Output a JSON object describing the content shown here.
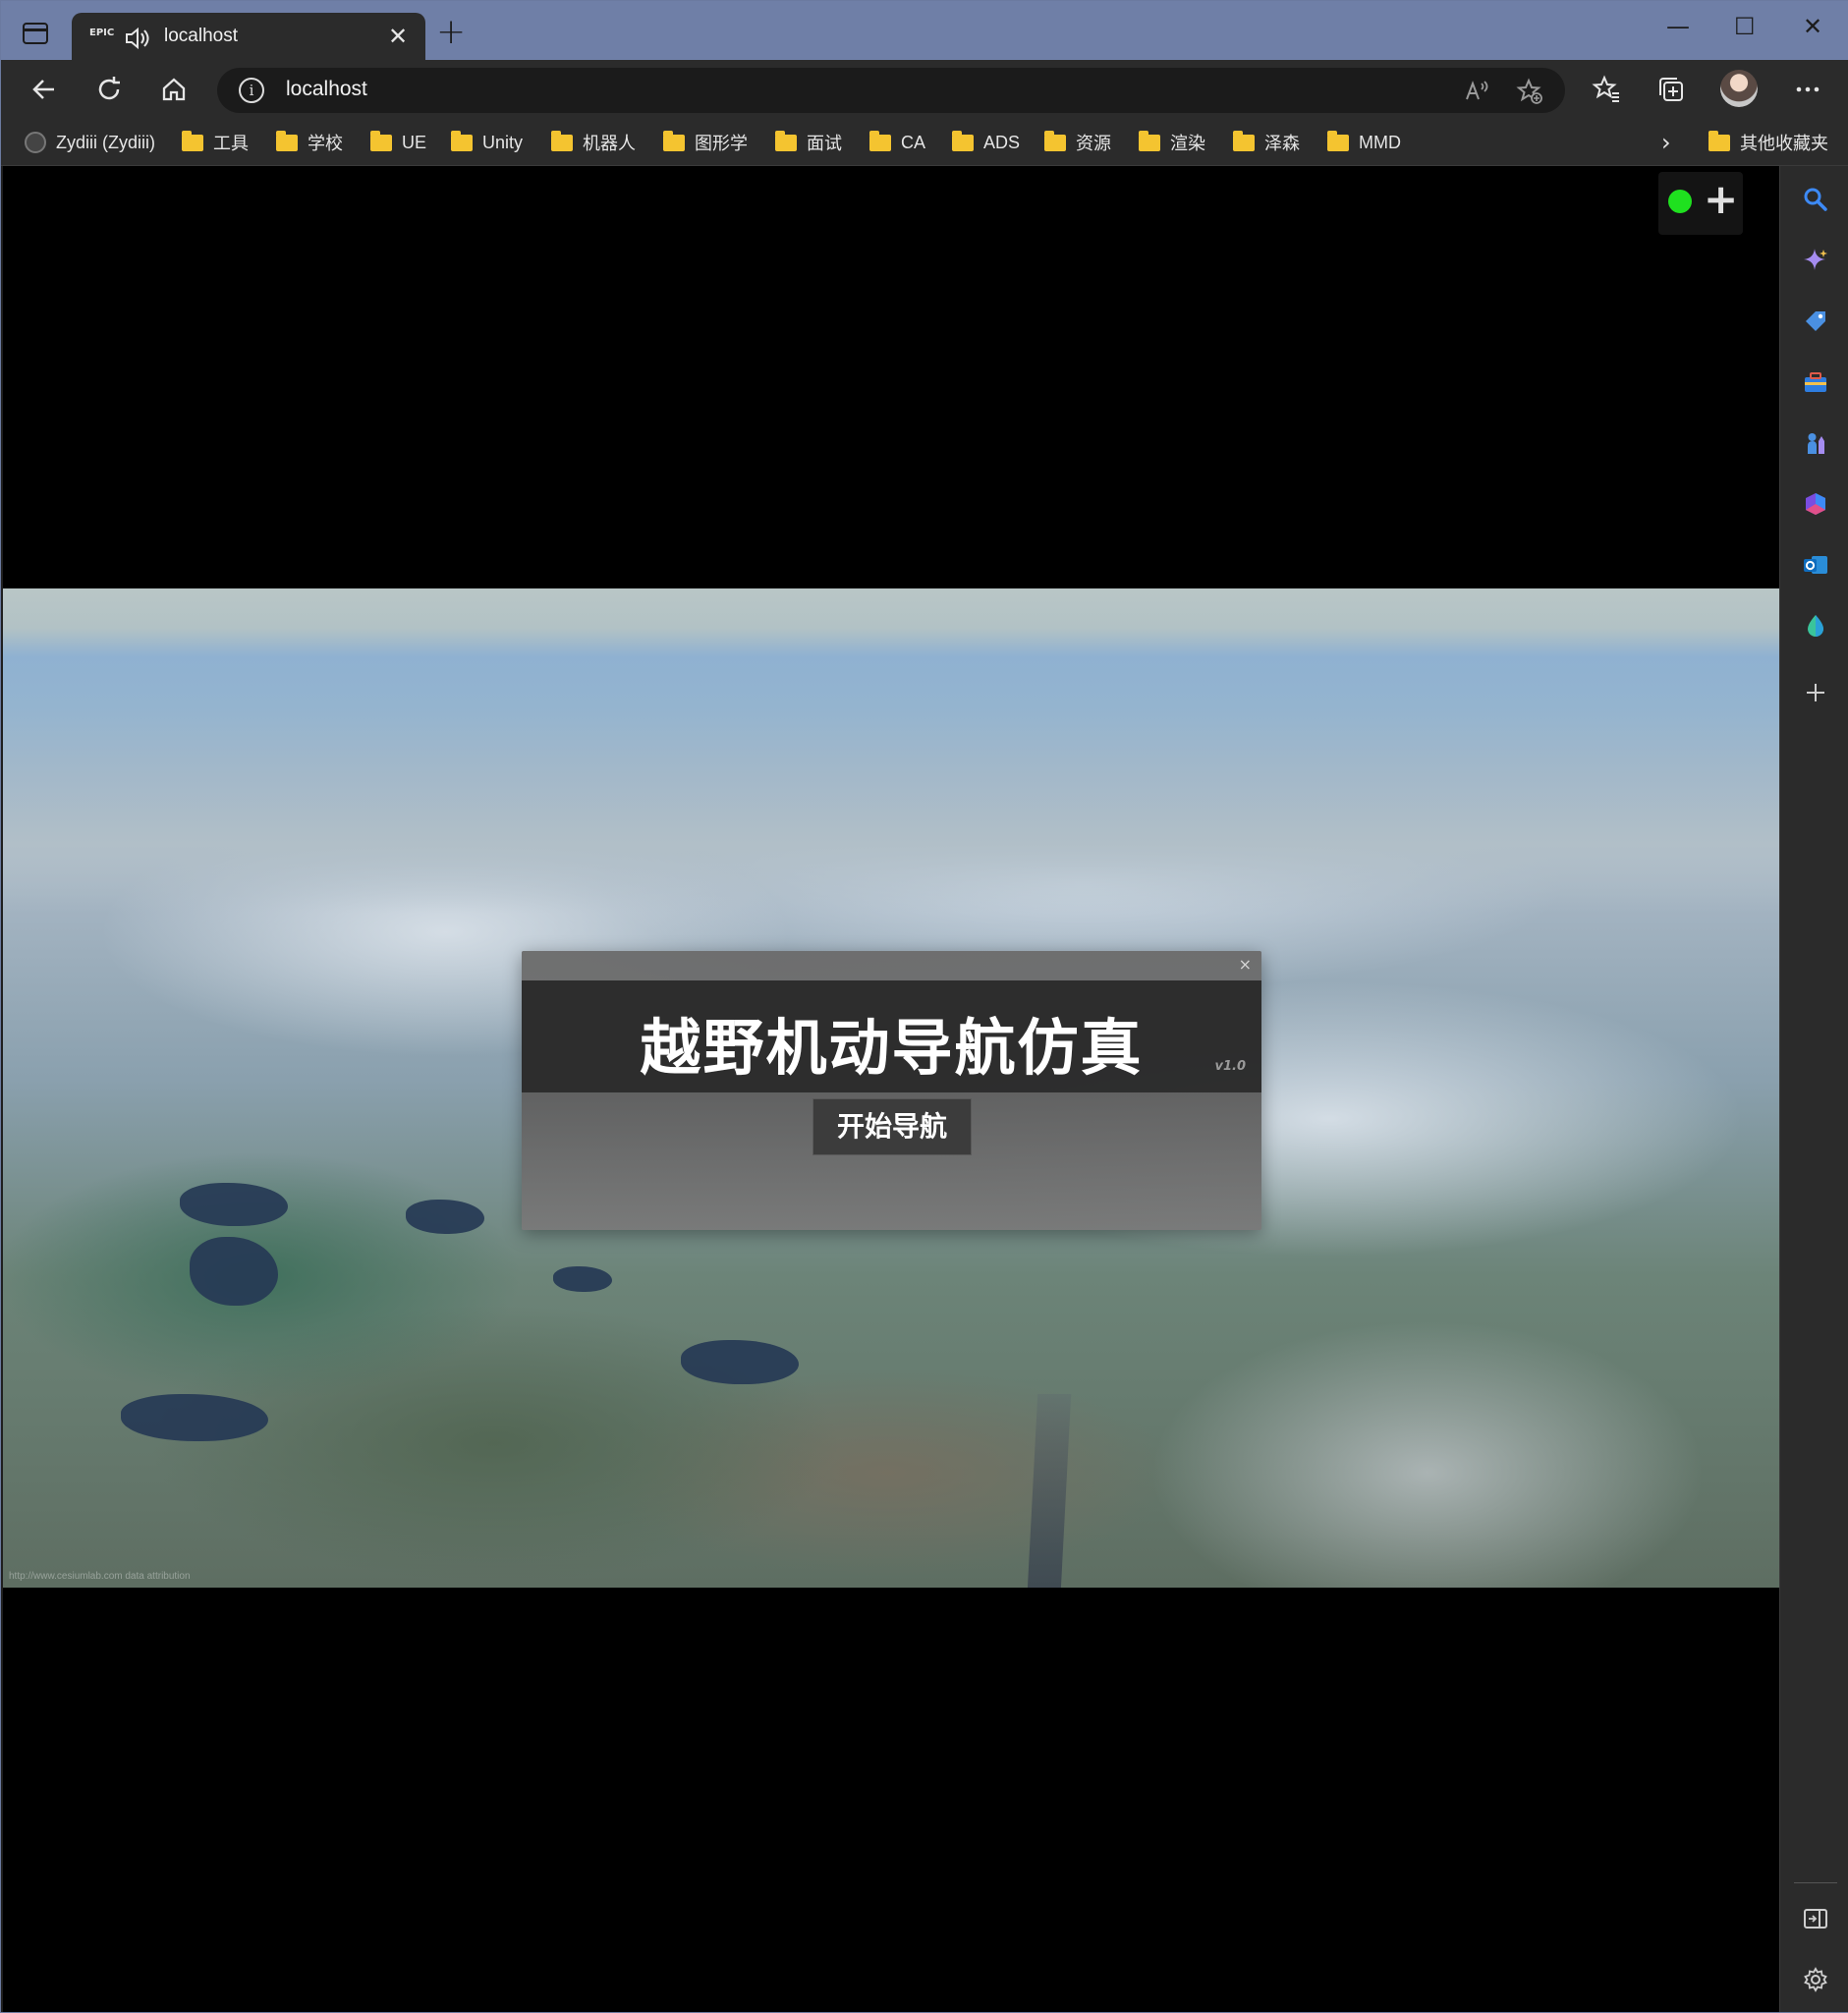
{
  "window": {
    "tab": {
      "favicon_text": "EPIC",
      "title": "localhost"
    },
    "controls": {
      "minimize": "—",
      "maximize": "☐",
      "close": "✕"
    }
  },
  "toolbar": {
    "url": "localhost"
  },
  "bookmarks": {
    "items": [
      {
        "label": "Zydiii (Zydiii)",
        "icon": "github-icon"
      },
      {
        "label": "工具",
        "icon": "folder-icon"
      },
      {
        "label": "学校",
        "icon": "folder-icon"
      },
      {
        "label": "UE",
        "icon": "folder-icon"
      },
      {
        "label": "Unity",
        "icon": "folder-icon"
      },
      {
        "label": "机器人",
        "icon": "folder-icon"
      },
      {
        "label": "图形学",
        "icon": "folder-icon"
      },
      {
        "label": "面试",
        "icon": "folder-icon"
      },
      {
        "label": "CA",
        "icon": "folder-icon"
      },
      {
        "label": "ADS",
        "icon": "folder-icon"
      },
      {
        "label": "资源",
        "icon": "folder-icon"
      },
      {
        "label": "渲染",
        "icon": "folder-icon"
      },
      {
        "label": "泽森",
        "icon": "folder-icon"
      },
      {
        "label": "MMD",
        "icon": "folder-icon"
      }
    ],
    "other_folder": "其他收藏夹"
  },
  "app": {
    "dialog": {
      "title": "越野机动导航仿真",
      "version": "v1.0",
      "start_button": "开始导航",
      "close": "×"
    },
    "overlay": {
      "status_color": "#1fe11f",
      "add_label": "+"
    },
    "watermark": "http://www.cesiumlab.com  data attribution"
  },
  "colors": {
    "titlebar": "#6f7fa7",
    "toolbar": "#2b2b2b",
    "folder": "#f4c430",
    "status_green": "#1fe11f"
  },
  "sidebar": {
    "icons": [
      "search-icon",
      "copilot-icon",
      "shopping-tag-icon",
      "tools-icon",
      "games-icon",
      "office-icon",
      "outlook-icon",
      "drop-icon",
      "add-icon",
      "hide-sidebar-icon",
      "settings-icon"
    ]
  }
}
